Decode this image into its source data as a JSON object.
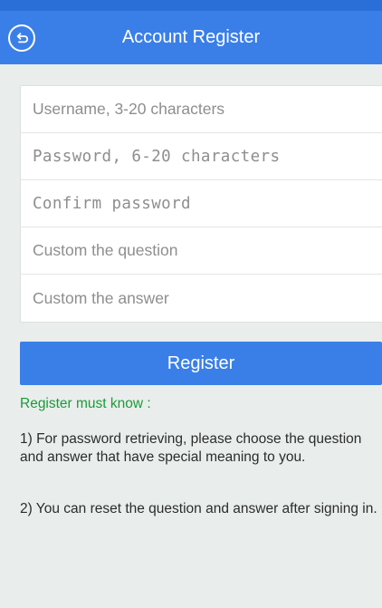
{
  "header": {
    "back_icon": "back-arrow-icon",
    "title": "Account Register",
    "color": "#3a7fe8"
  },
  "form": {
    "username": {
      "value": "",
      "placeholder": "Username, 3-20 characters"
    },
    "password": {
      "value": "",
      "placeholder": "Password, 6-20 characters"
    },
    "confirm_password": {
      "value": "",
      "placeholder": "Confirm password"
    },
    "question": {
      "value": "",
      "placeholder": "Custom the question"
    },
    "answer": {
      "value": "",
      "placeholder": "Custom the answer"
    }
  },
  "register_button": {
    "label": "Register"
  },
  "notice": {
    "title": "Register must know :",
    "title_color": "#1c9a3a",
    "items": [
      "1) For password retrieving, please choose the question and answer that have special meaning to you.",
      "2) You can reset the question and answer after signing in."
    ]
  }
}
